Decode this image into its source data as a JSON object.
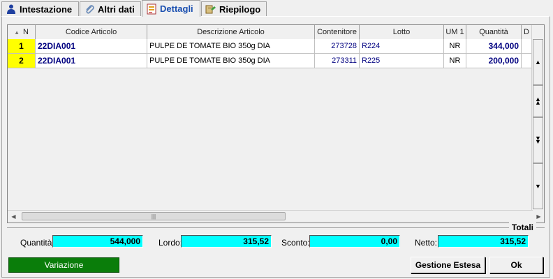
{
  "tabs": [
    {
      "label": "Intestazione",
      "icon": "person-icon"
    },
    {
      "label": "Altri dati",
      "icon": "paperclip-icon"
    },
    {
      "label": "Dettagli",
      "icon": "document-icon"
    },
    {
      "label": "Riepilogo",
      "icon": "summary-icon"
    }
  ],
  "active_tab": "Dettagli",
  "grid": {
    "columns": [
      "N",
      "Codice Articolo",
      "Descrizione Articolo",
      "Contenitore",
      "Lotto",
      "UM 1",
      "Quantità",
      "D"
    ],
    "rows": [
      {
        "n": "1",
        "code": "22DIA001",
        "desc": "PULPE DE TOMATE BIO 350g DIA",
        "container": "273728",
        "lot": "R224",
        "um": "NR",
        "qty": "344,000"
      },
      {
        "n": "2",
        "code": "22DIA001",
        "desc": "PULPE DE TOMATE BIO 350g DIA",
        "container": "273311",
        "lot": "R225",
        "um": "NR",
        "qty": "200,000"
      }
    ]
  },
  "totals": {
    "title": "Totali",
    "quantity_label": "Quantità:",
    "quantity_value": "544,000",
    "gross_label": "Lordo:",
    "gross_value": "315,52",
    "discount_label": "Sconto:",
    "discount_value": "0,00",
    "net_label": "Netto:",
    "net_value": "315,52"
  },
  "buttons": {
    "variation": "Variazione",
    "extended": "Gestione Estesa",
    "ok": "Ok"
  },
  "colors": {
    "total_field_bg": "#00ffff",
    "row_number_bg": "#ffff00",
    "variation_button_bg": "#0a7d0a",
    "active_tab_text": "#1a4fb0"
  }
}
